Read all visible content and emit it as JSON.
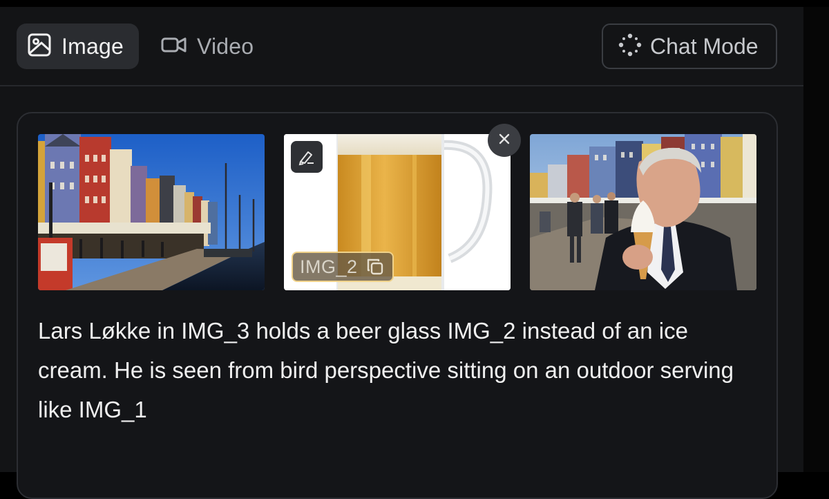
{
  "tabs": [
    {
      "label": "Image",
      "icon": "image-icon",
      "active": true
    },
    {
      "label": "Video",
      "icon": "video-camera-icon",
      "active": false
    }
  ],
  "chat_mode": {
    "label": "Chat Mode",
    "icon": "sparkle-dots-icon"
  },
  "attachments": [
    {
      "alt": "Nyhavn harbour with colourful houses and sailing ships",
      "tag": null
    },
    {
      "alt": "Glass mug of beer",
      "tag": "IMG_2"
    },
    {
      "alt": "Man in suit holding ice cream cone on harbour promenade",
      "tag": null
    }
  ],
  "prompt": "Lars Løkke in IMG_3 holds a beer glass IMG_2 instead of an ice cream. He is seen from bird perspective sitting on an outdoor serving like IMG_1",
  "colors": {
    "background": "#131416",
    "active_tab": "#2a2c30",
    "tag_border": "#f0d28a",
    "text": "#f0f0f0",
    "muted_text": "#a9acb1"
  }
}
